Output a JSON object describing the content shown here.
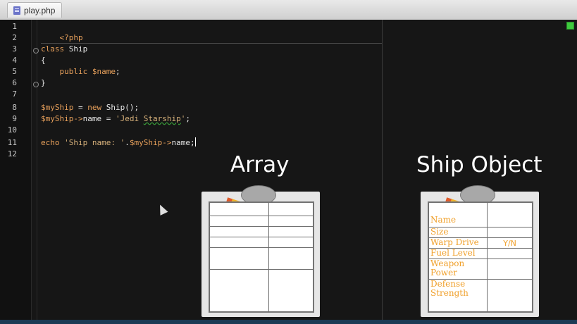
{
  "tab": {
    "label": "play.php",
    "icon": "php-file-icon"
  },
  "line_numbers": [
    "1",
    "2",
    "3",
    "4",
    "5",
    "6",
    "7",
    "8",
    "9",
    "10",
    "11",
    "12"
  ],
  "code": {
    "l1": "<?php",
    "l3_kw": "class",
    "l3_name": " Ship",
    "l4": "{",
    "l5_kw": "public",
    "l5_var": " $name",
    "l5_end": ";",
    "l6": "}",
    "l8_var": "$myShip",
    "l8_eq": " = ",
    "l8_new": "new",
    "l8_rest": " Ship();",
    "l9_var": "$myShip->",
    "l9_prop": "name",
    "l9_eq": " = ",
    "l9_q1": "'Jedi ",
    "l9_word": "Starship",
    "l9_q2": "'",
    "l9_end": ";",
    "l11_echo": "echo",
    "l11_str": " 'Ship name: '",
    "l11_dot": ".",
    "l11_var": "$myShip->",
    "l11_prop": "name",
    "l11_end": ";"
  },
  "array_heading": "Array",
  "object_heading": "Ship Object",
  "ship_fields": [
    {
      "key": "Name",
      "value": ""
    },
    {
      "key": "Size",
      "value": ""
    },
    {
      "key": "Warp Drive",
      "value": "Y/N"
    },
    {
      "key": "Fuel Level",
      "value": ""
    },
    {
      "key": "Weapon Power",
      "value": ""
    },
    {
      "key": "Defense Strength",
      "value": ""
    }
  ],
  "colors": {
    "keyword": "#e7a05b",
    "label_orange": "#f0a02b",
    "status_green": "#3ecb3e"
  }
}
